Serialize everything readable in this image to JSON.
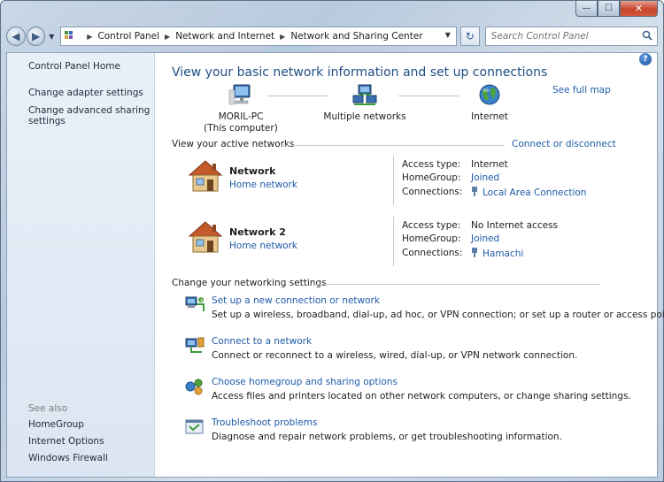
{
  "window": {
    "caption": {
      "minimize": "—",
      "maximize": "☐",
      "close": "✕"
    }
  },
  "navigation": {
    "back": "◀",
    "forward": "▶",
    "breadcrumbs": [
      "Control Panel",
      "Network and Internet",
      "Network and Sharing Center"
    ],
    "refresh": "↻",
    "search_placeholder": "Search Control Panel"
  },
  "sidebar": {
    "items": [
      {
        "label": "Control Panel Home"
      },
      {
        "label": "Change adapter settings"
      },
      {
        "label": "Change advanced sharing settings"
      }
    ],
    "see_also_label": "See also",
    "see_also": [
      {
        "label": "HomeGroup"
      },
      {
        "label": "Internet Options"
      },
      {
        "label": "Windows Firewall"
      }
    ]
  },
  "main": {
    "title": "View your basic network information and set up connections",
    "see_full_map": "See full map",
    "map_nodes": [
      {
        "label": "MORIL-PC",
        "sublabel": "(This computer)",
        "icon": "computer-icon"
      },
      {
        "label": "Multiple networks",
        "icon": "networks-icon"
      },
      {
        "label": "Internet",
        "icon": "globe-icon"
      }
    ],
    "active_networks_label": "View your active networks",
    "connect_or_disconnect": "Connect or disconnect",
    "networks": [
      {
        "name": "Network",
        "type": "Home network",
        "access_type_key": "Access type:",
        "access_type": "Internet",
        "homegroup_key": "HomeGroup:",
        "homegroup": "Joined",
        "connections_key": "Connections:",
        "connection": "Local Area Connection"
      },
      {
        "name": "Network  2",
        "type": "Home network",
        "access_type_key": "Access type:",
        "access_type": "No Internet access",
        "homegroup_key": "HomeGroup:",
        "homegroup": "Joined",
        "connections_key": "Connections:",
        "connection": "Hamachi"
      }
    ],
    "change_settings_label": "Change your networking settings",
    "tasks": [
      {
        "title": "Set up a new connection or network",
        "description": "Set up a wireless, broadband, dial-up, ad hoc, or VPN connection; or set up a router or access point.",
        "icon": "new-connection-icon"
      },
      {
        "title": "Connect to a network",
        "description": "Connect or reconnect to a wireless, wired, dial-up, or VPN network connection.",
        "icon": "connect-network-icon"
      },
      {
        "title": "Choose homegroup and sharing options",
        "description": "Access files and printers located on other network computers, or change sharing settings.",
        "icon": "homegroup-icon"
      },
      {
        "title": "Troubleshoot problems",
        "description": "Diagnose and repair network problems, or get troubleshooting information.",
        "icon": "troubleshoot-icon"
      }
    ]
  },
  "colors": {
    "link": "#1f5aa8",
    "title": "#1f4f84",
    "sidebar_bg": "#e9f0f8"
  }
}
